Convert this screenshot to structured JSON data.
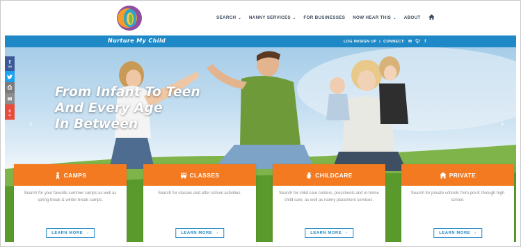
{
  "brand": {
    "name": "Nurture My Child"
  },
  "nav": {
    "items": [
      {
        "label": "SEARCH",
        "caret": true
      },
      {
        "label": "NANNY SERVICES",
        "caret": true
      },
      {
        "label": "FOR BUSINESSES",
        "caret": false
      },
      {
        "label": "NOW HEAR THIS",
        "caret": true
      },
      {
        "label": "ABOUT",
        "caret": false
      }
    ],
    "caret_glyph": "⌄"
  },
  "topbar": {
    "login": "LOG IN/SIGN UP",
    "separator": "|",
    "connect": "CONNECT:",
    "social_icons": [
      "email-icon",
      "twitter-icon",
      "facebook-icon"
    ]
  },
  "hero": {
    "headline": [
      "From Infant To Teen",
      "And Every Age",
      "In Between"
    ],
    "prev_arrow": "‹",
    "next_arrow": "›"
  },
  "social_sidebar": [
    {
      "icon": "facebook-icon",
      "glyph": "f",
      "count": "105"
    },
    {
      "icon": "twitter-icon",
      "glyph": "t",
      "count": ""
    },
    {
      "icon": "print-icon",
      "glyph": "⎙",
      "count": ""
    },
    {
      "icon": "email-icon",
      "glyph": "✉",
      "count": ""
    },
    {
      "icon": "plus-icon",
      "glyph": "+",
      "count": "34"
    }
  ],
  "cards": [
    {
      "title": "CAMPS",
      "icon": "camp-icon",
      "desc": "Search for your favorite summer camps as well as spring break & winter break camps.",
      "button": "LEARN MORE"
    },
    {
      "title": "CLASSES",
      "icon": "bus-icon",
      "desc": "Search for classes and after school activities.",
      "button": "LEARN MORE"
    },
    {
      "title": "CHILDCARE",
      "icon": "hand-icon",
      "desc": "Search for child care centers, preschools and in-home child care, as well as nanny placement services.",
      "button": "LEARN MORE"
    },
    {
      "title": "PRIVATE",
      "icon": "school-icon",
      "desc": "Search for private schools from pre-K through high school.",
      "button": "LEARN MORE"
    }
  ],
  "button_chevron": "›",
  "colors": {
    "accent_orange": "#f37a21",
    "brand_blue": "#1e89c6",
    "nav_text": "#3b4a5c"
  }
}
